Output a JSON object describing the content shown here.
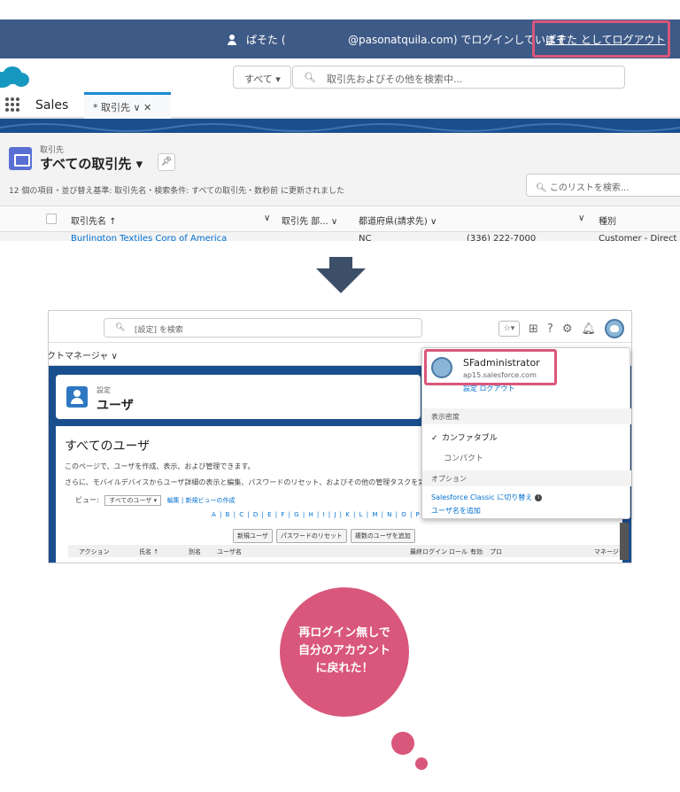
{
  "top": {
    "banner": {
      "user_name": "ぱそた (",
      "login_message": "@pasonatquila.com) でログインしています",
      "logout_link": "ぱそた としてログアウト"
    },
    "search": {
      "scope": "すべて ▾",
      "placeholder": "取引先およびその他を検索中..."
    },
    "nav": {
      "app_name": "Sales",
      "tab_label": "* 取引先 ∨ ✕"
    },
    "list": {
      "object_label": "取引先",
      "title": "すべての取引先 ▾",
      "meta": "12 個の項目・並び替え基準: 取引先名・検索条件: すべての取引先・数秒前 に更新されました",
      "search_placeholder": "このリストを検索...",
      "columns": [
        "取引先名 ↑",
        "∨",
        "取引先 部... ∨",
        "都道府県(請求先) ∨",
        "∨",
        "種別"
      ],
      "row": {
        "account": "Burlington Textiles Corp of America",
        "state": "NC",
        "phone": "(336) 222-7000",
        "type": "Customer - Direct"
      }
    }
  },
  "bottom": {
    "search_placeholder": "[設定] を検索",
    "nav_label": "クトマネージャ ∨",
    "card": {
      "small": "設定",
      "big": "ユーザ"
    },
    "main": {
      "heading": "すべてのユーザ",
      "desc1": "このページで、ユーザを作成、表示、および管理できます。",
      "desc2": "さらに、モバイルデバイスからユーザ詳細の表示と編集、パスワードのリセット、およびその他の管理タスクを実行するには、Sales",
      "view_label": "ビュー:",
      "view_select": "すべてのユーザ ▾",
      "view_links": "編集 | 新規ビューの作成",
      "alphabet": "A | B | C | D | E | F | G | H | I | J | K | L | M | N | O | P | Q | R | S | T | U | V",
      "buttons": [
        "新規ユーザ",
        "パスワードのリセット",
        "複数のユーザを追加"
      ],
      "table_headers": [
        "アクション",
        "氏名 ↑",
        "別名",
        "ユーザ名",
        "最終ログイン",
        "ロール",
        "有効",
        "プロ",
        "マネージャ"
      ]
    },
    "dropdown": {
      "name": "SFadministrator",
      "domain": "ap15.salesforce.com",
      "links": "設定  ログアウト",
      "density_header": "表示密度",
      "comfy": "カンファタブル",
      "compact": "コンパクト",
      "options_header": "オプション",
      "switch_classic": "Salesforce Classic に切り替え",
      "add_username": "ユーザ名を追加"
    }
  },
  "bubble": {
    "line1": "再ログイン無しで",
    "line2": "自分のアカウント",
    "line3": "に戻れた！"
  },
  "colors": {
    "highlight": "#d9577a",
    "banner": "#3e5a87",
    "arrow": "#3d4f68",
    "link": "#0070d2"
  }
}
